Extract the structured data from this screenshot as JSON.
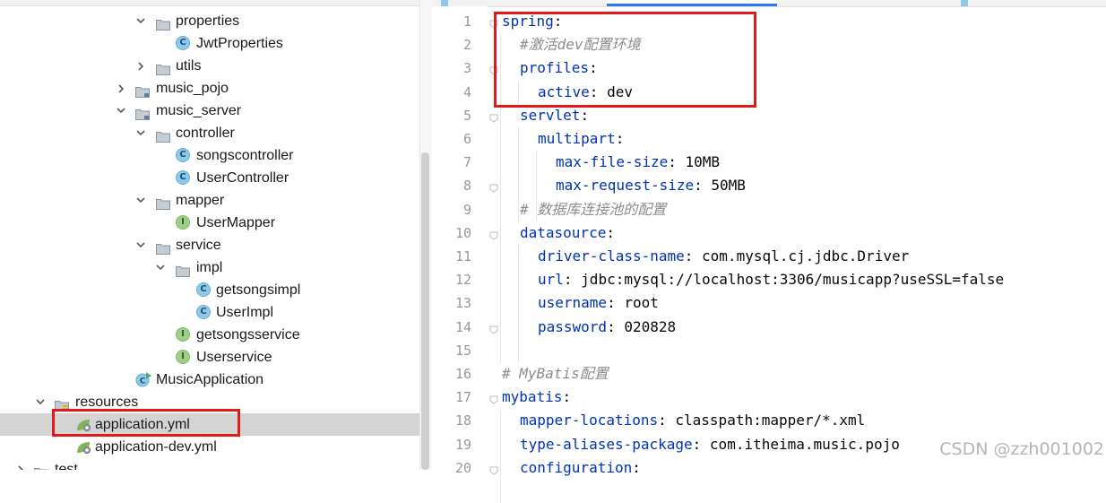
{
  "tree": {
    "rows": [
      {
        "label": "properties",
        "kind": "folder",
        "expanded": true
      },
      {
        "label": "JwtProperties",
        "kind": "class"
      },
      {
        "label": "utils",
        "kind": "folder",
        "expanded": false
      },
      {
        "label": "music_pojo",
        "kind": "module",
        "expanded": false
      },
      {
        "label": "music_server",
        "kind": "module",
        "expanded": true
      },
      {
        "label": "controller",
        "kind": "folder",
        "expanded": true
      },
      {
        "label": "songscontroller",
        "kind": "class"
      },
      {
        "label": "UserController",
        "kind": "class"
      },
      {
        "label": "mapper",
        "kind": "folder",
        "expanded": true
      },
      {
        "label": "UserMapper",
        "kind": "interface"
      },
      {
        "label": "service",
        "kind": "folder",
        "expanded": true
      },
      {
        "label": "impl",
        "kind": "folder",
        "expanded": true
      },
      {
        "label": "getsongsimpl",
        "kind": "class"
      },
      {
        "label": "UserImpl",
        "kind": "class"
      },
      {
        "label": "getsongsservice",
        "kind": "interface"
      },
      {
        "label": "Userservice",
        "kind": "interface"
      },
      {
        "label": "MusicApplication",
        "kind": "app"
      },
      {
        "label": "resources",
        "kind": "resources",
        "expanded": true
      },
      {
        "label": "application.yml",
        "kind": "yml",
        "selected": true
      },
      {
        "label": "application-dev.yml",
        "kind": "yml"
      },
      {
        "label": "test",
        "kind": "folder",
        "expanded": false
      }
    ]
  },
  "editor": {
    "lines": [
      {
        "n": "1",
        "indent": 0,
        "key": "spring",
        "sep": ":",
        "value": "",
        "comment": ""
      },
      {
        "n": "2",
        "indent": 1,
        "key": "",
        "sep": "",
        "value": "",
        "comment": "#激活dev配置环境"
      },
      {
        "n": "3",
        "indent": 1,
        "key": "profiles",
        "sep": ":",
        "value": "",
        "comment": ""
      },
      {
        "n": "4",
        "indent": 2,
        "key": "active",
        "sep": ": ",
        "value": "dev",
        "comment": ""
      },
      {
        "n": "5",
        "indent": 1,
        "key": "servlet",
        "sep": ":",
        "value": "",
        "comment": ""
      },
      {
        "n": "6",
        "indent": 2,
        "key": "multipart",
        "sep": ":",
        "value": "",
        "comment": ""
      },
      {
        "n": "7",
        "indent": 3,
        "key": "max-file-size",
        "sep": ": ",
        "value": "10MB",
        "comment": ""
      },
      {
        "n": "8",
        "indent": 3,
        "key": "max-request-size",
        "sep": ": ",
        "value": "50MB",
        "comment": ""
      },
      {
        "n": "9",
        "indent": 1,
        "key": "",
        "sep": "",
        "value": "",
        "comment": "# 数据库连接池的配置"
      },
      {
        "n": "10",
        "indent": 1,
        "key": "datasource",
        "sep": ":",
        "value": "",
        "comment": ""
      },
      {
        "n": "11",
        "indent": 2,
        "key": "driver-class-name",
        "sep": ": ",
        "value": "com.mysql.cj.jdbc.Driver",
        "comment": ""
      },
      {
        "n": "12",
        "indent": 2,
        "key": "url",
        "sep": ": ",
        "value": "jdbc:mysql://localhost:3306/musicapp?useSSL=false",
        "comment": ""
      },
      {
        "n": "13",
        "indent": 2,
        "key": "username",
        "sep": ": ",
        "value": "root",
        "comment": ""
      },
      {
        "n": "14",
        "indent": 2,
        "key": "password",
        "sep": ": ",
        "value": "020828",
        "comment": ""
      },
      {
        "n": "15",
        "indent": 0,
        "key": "",
        "sep": "",
        "value": "",
        "comment": ""
      },
      {
        "n": "16",
        "indent": 0,
        "key": "",
        "sep": "",
        "value": "",
        "comment": "# MyBatis配置"
      },
      {
        "n": "17",
        "indent": 0,
        "key": "mybatis",
        "sep": ":",
        "value": "",
        "comment": ""
      },
      {
        "n": "18",
        "indent": 1,
        "key": "mapper-locations",
        "sep": ": ",
        "value": "classpath:mapper/*.xml",
        "comment": ""
      },
      {
        "n": "19",
        "indent": 1,
        "key": "type-aliases-package",
        "sep": ": ",
        "value": "com.itheima.music.pojo",
        "comment": ""
      },
      {
        "n": "20",
        "indent": 1,
        "key": "configuration",
        "sep": ":",
        "value": "",
        "comment": ""
      }
    ]
  },
  "colors": {
    "key": "#0033b3",
    "comment": "#8c8c8c",
    "annotation": "#e01b1b",
    "selection": "#d4d4d4"
  },
  "watermark": "CSDN @zzh001002"
}
